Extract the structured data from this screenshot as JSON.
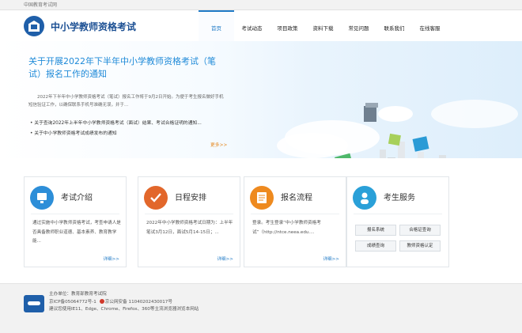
{
  "topbar": {
    "text": "中国教育考试网"
  },
  "header": {
    "site_title": "中小学教师资格考试",
    "nav": [
      "首页",
      "考试动态",
      "项目政策",
      "资料下载",
      "常见问题",
      "联系我们",
      "在线客服"
    ],
    "active_nav": "首页"
  },
  "hero": {
    "title": "关于开展2022年下半年中小学教师资格考试（笔试）报名工作的通知",
    "desc": "2022年下半年中小学教师资格考试（笔试）报名工作将于9月2日开始。为便于考生报名做好手机短信验证工作，以确保联系手机号准确无误，并于...",
    "list": [
      "关于查询2022年上半年中小学教师资格考试（面试）结果、考试合格证明的通知...",
      "关于中小学教师资格考试成绩发布的通知"
    ],
    "more": "更多>>"
  },
  "cards": [
    {
      "title": "考试介绍",
      "body": "通过实施中小学教师资格考试，考查申请人是否具备教师职业道德、基本素养、教育教学能...",
      "more": "详细>>",
      "icon": "monitor-icon",
      "color": "#2d8ed8"
    },
    {
      "title": "日程安排",
      "body": "2022年中小学教师资格考试日期为：上半年笔试3月12日，面试5月14-15日；...",
      "more": "详细>>",
      "icon": "check-icon",
      "color": "#e2672b"
    },
    {
      "title": "报名流程",
      "body": "登录。考生登录“中小学教师资格考试”（http://ntce.neea.edu....",
      "more": "详细>>",
      "icon": "document-icon",
      "color": "#ee8a1f"
    },
    {
      "title": "考生服务",
      "icon": "person-icon",
      "color": "#2aa0d8",
      "buttons": [
        "报名系统",
        "合格证查询",
        "成绩查询",
        "教师资格认定"
      ]
    }
  ],
  "footer": {
    "lines": [
      "主办单位：教育部教育考试院",
      "京ICP备05064772号-1",
      "京公网安备 11040202430017号",
      "建议您使用IE11、Edge、Chrome、Firefox、360等主流浏览器浏览本网站"
    ],
    "logo_text": "教育考试院"
  }
}
